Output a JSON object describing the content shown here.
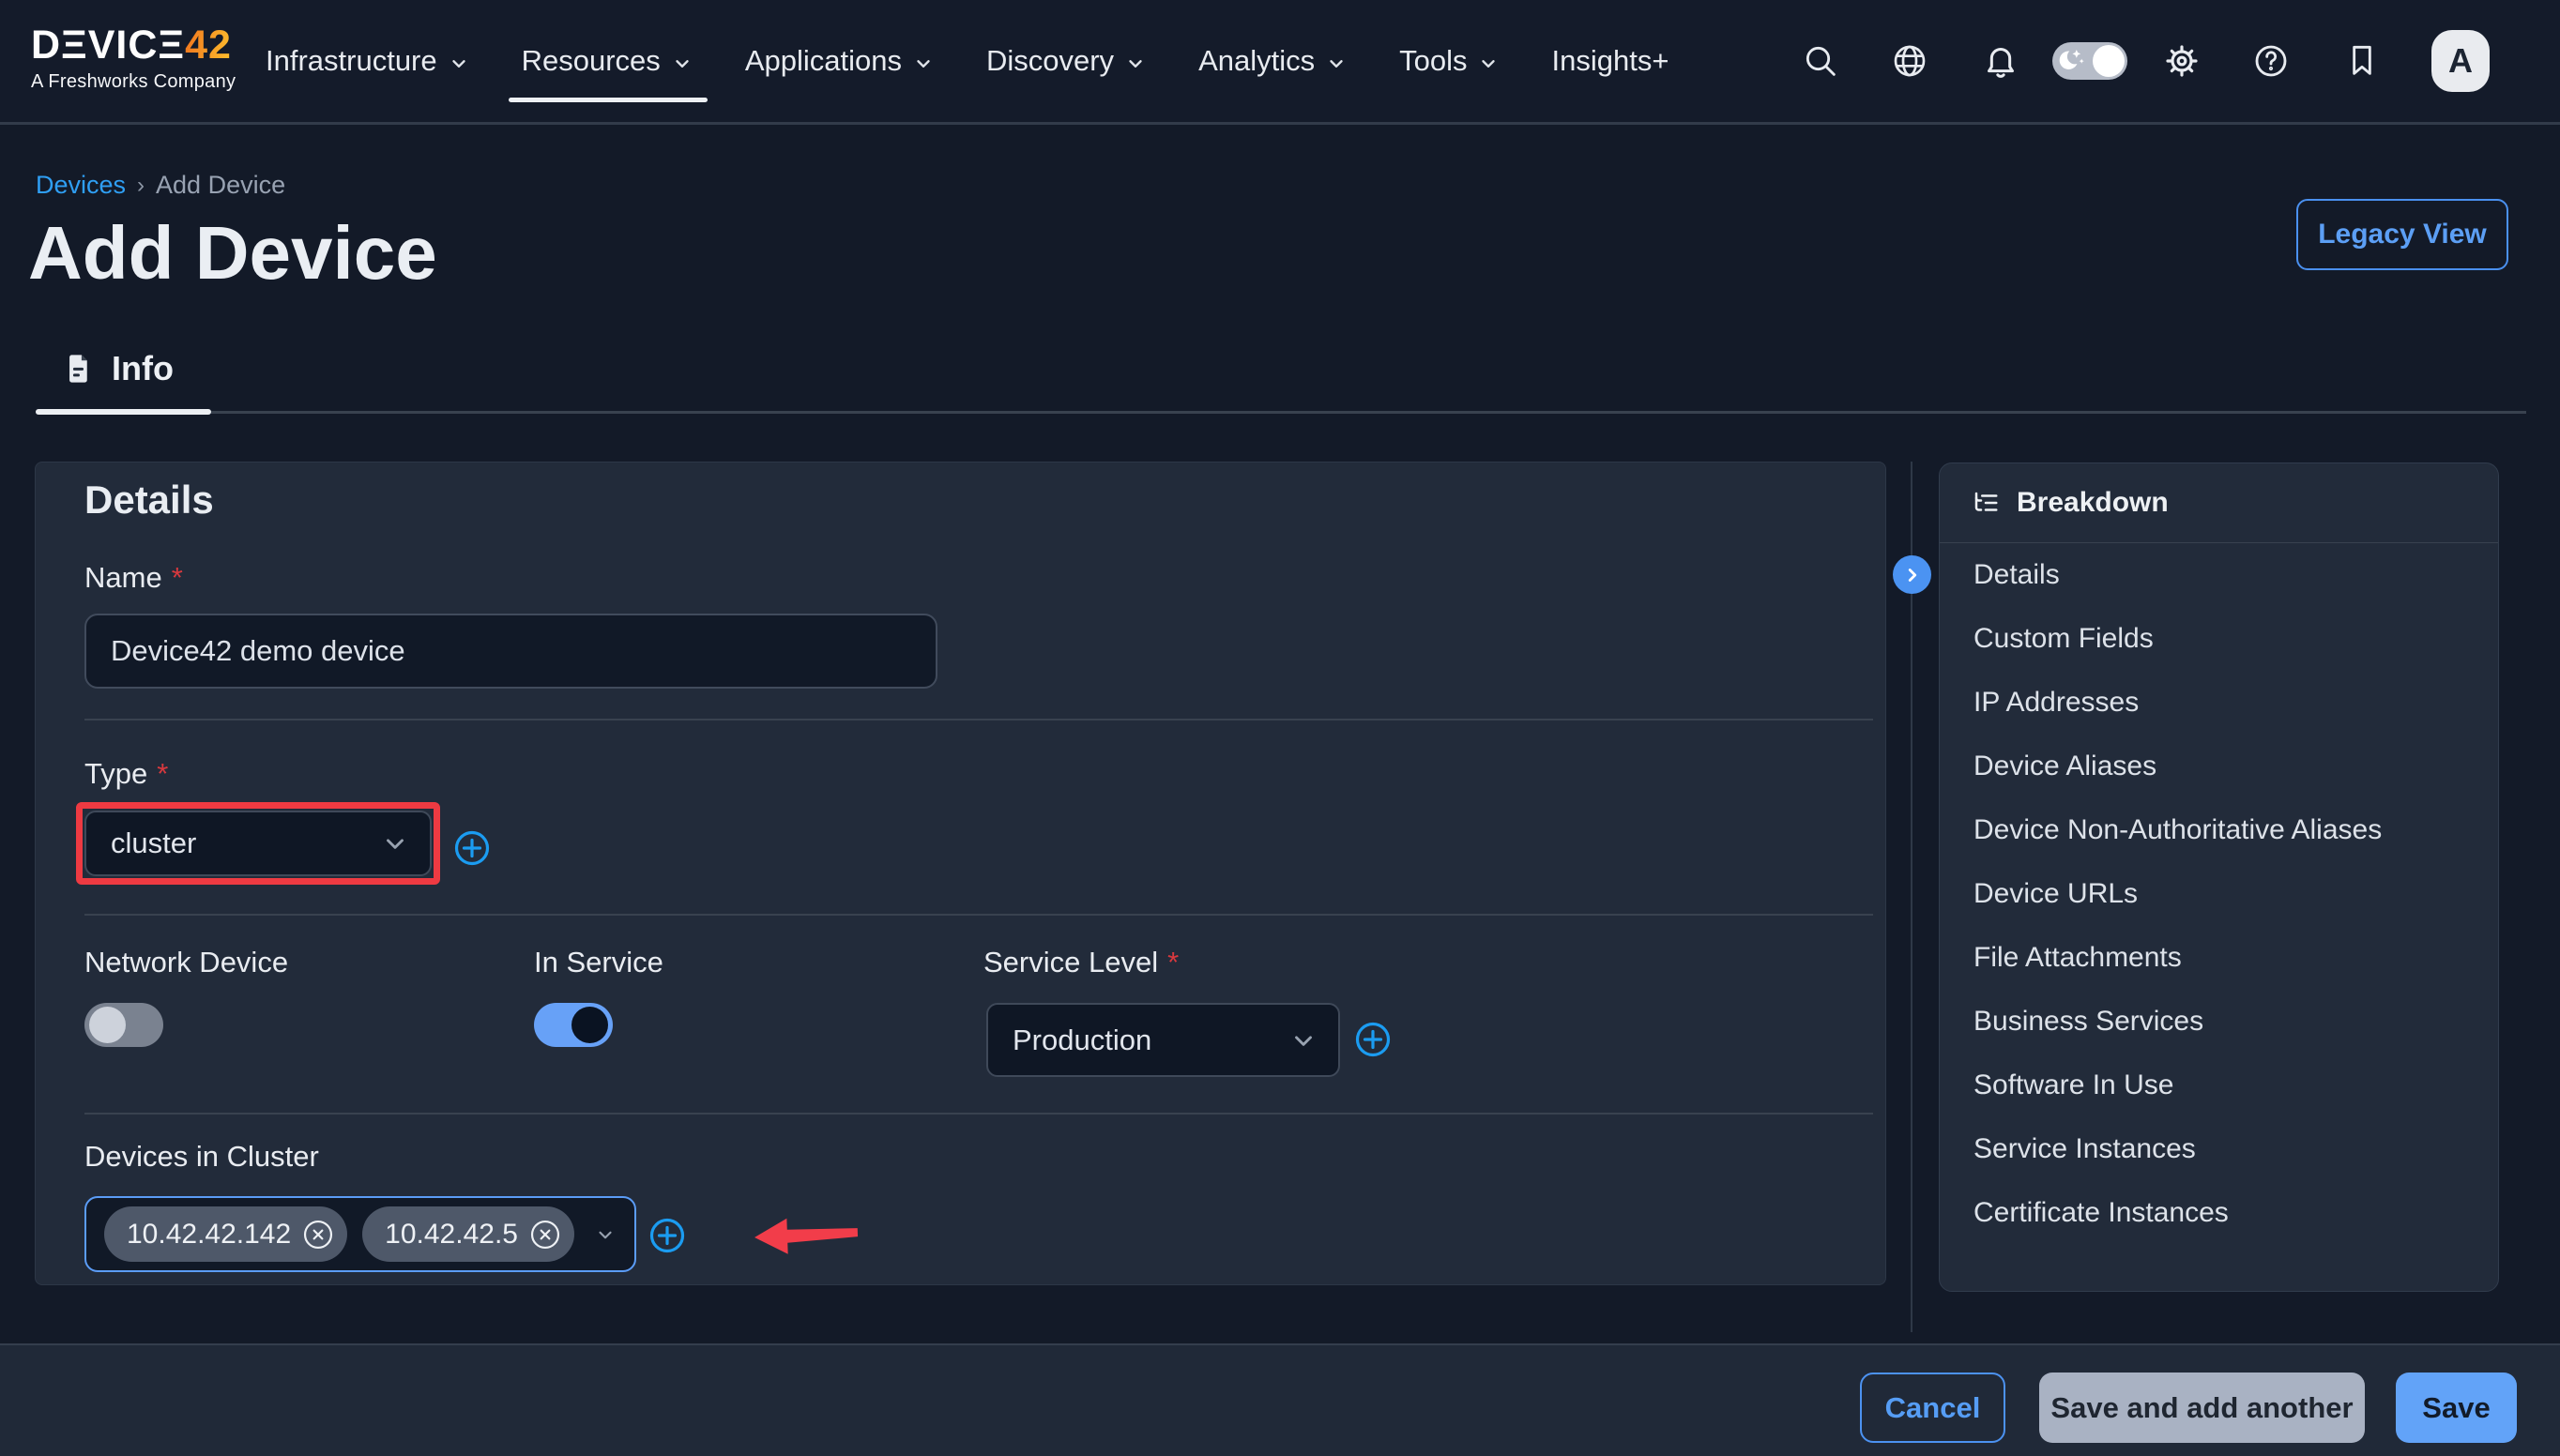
{
  "nav": {
    "brand": {
      "name": "DΞVICΞ",
      "number": "42",
      "tagline": "A Freshworks Company"
    },
    "items": [
      {
        "label": "Infrastructure"
      },
      {
        "label": "Resources"
      },
      {
        "label": "Applications"
      },
      {
        "label": "Discovery"
      },
      {
        "label": "Analytics"
      },
      {
        "label": "Tools"
      },
      {
        "label": "Insights+"
      }
    ],
    "avatar_initial": "A"
  },
  "breadcrumb": {
    "parent": "Devices",
    "separator": "›",
    "current": "Add Device"
  },
  "page": {
    "title": "Add Device",
    "legacy_button": "Legacy View"
  },
  "tabs": {
    "info": "Info"
  },
  "form": {
    "section_title": "Details",
    "required_marker": "*",
    "name": {
      "label": "Name",
      "value": "Device42 demo device"
    },
    "type": {
      "label": "Type",
      "value": "cluster"
    },
    "network_device": {
      "label": "Network Device",
      "state": "off"
    },
    "in_service": {
      "label": "In Service",
      "state": "on"
    },
    "service_level": {
      "label": "Service Level",
      "value": "Production"
    },
    "devices_in_cluster": {
      "label": "Devices in Cluster",
      "chips": [
        "10.42.42.142",
        "10.42.42.5"
      ]
    }
  },
  "breakdown": {
    "title": "Breakdown",
    "items": [
      "Details",
      "Custom Fields",
      "IP Addresses",
      "Device Aliases",
      "Device Non-Authoritative Aliases",
      "Device URLs",
      "File Attachments",
      "Business Services",
      "Software In Use",
      "Service Instances",
      "Certificate Instances"
    ]
  },
  "footer": {
    "cancel": "Cancel",
    "save_and_add": "Save and add another",
    "save": "Save"
  },
  "colors": {
    "accent_blue": "#5b9cf6",
    "link_blue": "#2f9ff4",
    "plus_blue": "#1b9cf1",
    "red": "#ee3a42",
    "chip_bg": "#4e5869"
  }
}
